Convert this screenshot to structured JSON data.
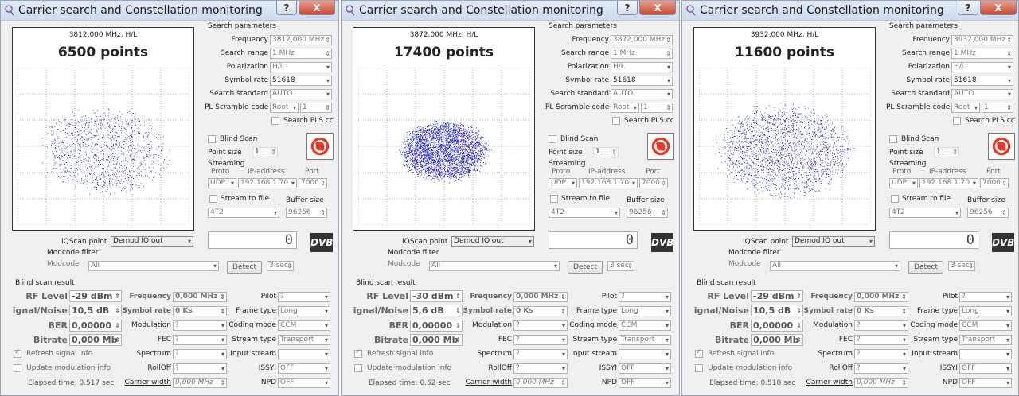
{
  "windows": [
    {
      "title": "Carrier search and Constellation monitoring",
      "plot": {
        "freq_label": "3812,000 MHz, H/L",
        "points_label": "6500 points",
        "cloud": {
          "spread": 0.8,
          "density": 1100,
          "seed": 7
        }
      },
      "search": {
        "frequency": "3812,000 MHz",
        "range": "1 MHz",
        "polarization": "H/L",
        "symbol_rate": "51618",
        "standard": "AUTO",
        "pl_scramble": "Root",
        "pl_value": "1"
      },
      "point_size": "1",
      "ip": "192.168.1.70",
      "port": "7000",
      "buffer_size": "96256",
      "stream_type_sel": "4T2",
      "rf_level": "-29 dBm",
      "snr": "10,5 dB",
      "ber": "0,00000",
      "bitrate": "0,000 Mb",
      "elapsed": "Elapsed time: 0.517 sec"
    },
    {
      "title": "Carrier search and Constellation monitoring",
      "plot": {
        "freq_label": "3872,000 MHz, H/L",
        "points_label": "17400 points",
        "cloud": {
          "spread": 0.55,
          "density": 3200,
          "seed": 13
        }
      },
      "search": {
        "frequency": "3872,000 MHz",
        "range": "1 MHz",
        "polarization": "H/L",
        "symbol_rate": "51618",
        "standard": "AUTO",
        "pl_scramble": "Root",
        "pl_value": "1"
      },
      "point_size": "1",
      "ip": "192.168.1.70",
      "port": "7000",
      "buffer_size": "96256",
      "stream_type_sel": "4T2",
      "rf_level": "-30 dBm",
      "snr": "5,6 dB",
      "ber": "0,00000",
      "bitrate": "0,000 Mb",
      "elapsed": "Elapsed time: 0.52 sec"
    },
    {
      "title": "Carrier search and Constellation monitoring",
      "plot": {
        "freq_label": "3932,000 MHz, H/L",
        "points_label": "11600 points",
        "cloud": {
          "spread": 0.85,
          "density": 2000,
          "seed": 21
        }
      },
      "search": {
        "frequency": "3932,000 MHz",
        "range": "1 MHz",
        "polarization": "H/L",
        "symbol_rate": "51618",
        "standard": "AUTO",
        "pl_scramble": "Root",
        "pl_value": "1"
      },
      "point_size": "1",
      "ip": "192.168.1.70",
      "port": "7000",
      "buffer_size": "96256",
      "stream_type_sel": "4T2",
      "rf_level": "-29 dBm",
      "snr": "10,5 dB",
      "ber": "0,00000",
      "bitrate": "0,000 Mb",
      "elapsed": "Elapsed time: 0.518 sec"
    }
  ],
  "labels": {
    "help": "?",
    "close": "X",
    "search_params": "Search parameters",
    "frequency": "Frequency",
    "search_range": "Search range",
    "polarization": "Polarization",
    "symbol_rate": "Symbol rate",
    "search_standard": "Search standard",
    "pl_scramble": "PL Scramble code",
    "search_pls": "Search PLS cc",
    "blind_scan": "Blind Scan",
    "point_size": "Point size",
    "streaming": "Streaming",
    "proto": "Proto",
    "ip_address": "IP-address",
    "port": "Port",
    "udp": "UDP",
    "stream_to_file": "Stream to file",
    "buffer_size": "Buffer size",
    "iqscan_point": "IQScan point",
    "iqscan_value": "Demod IQ out",
    "seg_value": "0",
    "dvb": "DVB",
    "modcode_filter": "Modcode filter",
    "modcode": "Modcode",
    "all": "All",
    "detect": "Detect",
    "sec": "3 sec",
    "blind_result": "Blind scan result",
    "rf_level": "RF Level",
    "signal_noise": "ignal/Noise",
    "ber": "BER",
    "bitrate": "Bitrate",
    "frequency_r": "Frequency",
    "frequency_val": "0,000 MHz",
    "symbol_rate_r": "Symbol rate",
    "symbol_val": "0 Ks",
    "modulation": "Modulation",
    "fec": "FEC",
    "spectrum": "Spectrum",
    "rolloff": "RollOff",
    "carrier_width": "Carrier width",
    "carrier_val": "0,000 MHz",
    "q": "?",
    "pilot": "Pilot",
    "frame_type": "Frame type",
    "frame_val": "Long",
    "coding_mode": "Coding mode",
    "coding_val": "CCM",
    "stream_type": "Stream type",
    "stream_val": "Transport",
    "input_stream": "Input stream",
    "issyi": "ISSYI",
    "off": "OFF",
    "npd": "NPD",
    "refresh": "Refresh signal info",
    "update_mod": "Update modulation info"
  },
  "colors": {
    "dots": "#1a1adb",
    "grid": "#666666"
  }
}
